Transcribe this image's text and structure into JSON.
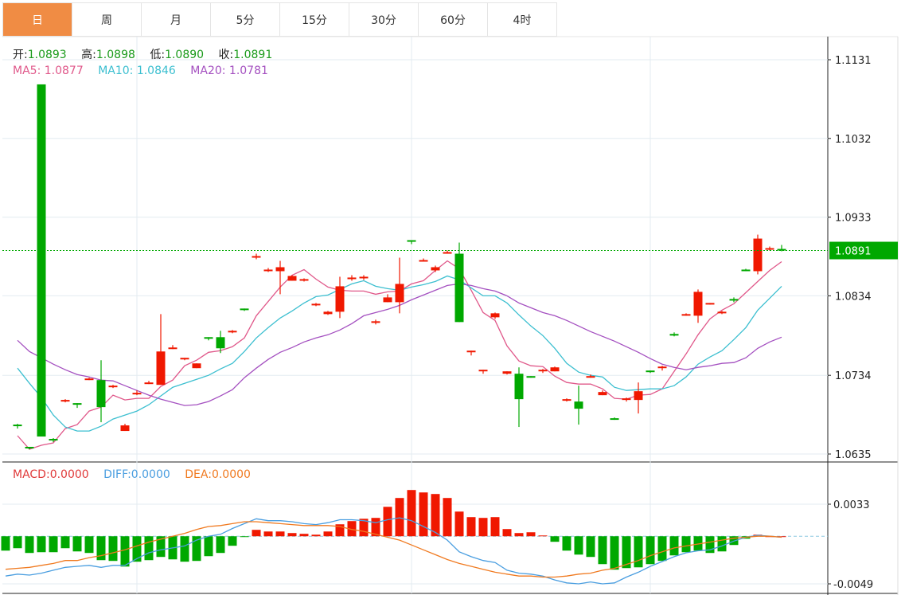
{
  "tabs": [
    {
      "label": "日",
      "active": true
    },
    {
      "label": "周",
      "active": false
    },
    {
      "label": "月",
      "active": false
    },
    {
      "label": "5分",
      "active": false
    },
    {
      "label": "15分",
      "active": false
    },
    {
      "label": "30分",
      "active": false
    },
    {
      "label": "60分",
      "active": false
    },
    {
      "label": "4时",
      "active": false
    }
  ],
  "ohlc_legend": {
    "open_label": "开:",
    "open": "1.0893",
    "high_label": "高:",
    "high": "1.0898",
    "low_label": "低:",
    "low": "1.0890",
    "close_label": "收:",
    "close": "1.0891"
  },
  "ma_legend": {
    "ma5_label": "MA5:",
    "ma5": "1.0877",
    "ma10_label": "MA10:",
    "ma10": "1.0846",
    "ma20_label": "MA20:",
    "ma20": "1.0781"
  },
  "macd_legend": {
    "macd_label": "MACD:",
    "macd": "0.0000",
    "diff_label": "DIFF:",
    "diff": "0.0000",
    "dea_label": "DEA:",
    "dea": "0.0000"
  },
  "colors": {
    "up": "#f01800",
    "down": "#00a800",
    "ma5": "#e0588a",
    "ma10": "#3cbfd0",
    "ma20": "#a450c0",
    "diff": "#4a9ee0",
    "dea": "#f07a20",
    "macd": "#e03a3a",
    "active_tab": "#f08c44"
  },
  "chart_data": [
    {
      "type": "candlestick",
      "title": "",
      "y_ticks": [
        "1.1131",
        "1.1032",
        "1.0933",
        "1.0834",
        "1.0734",
        "1.0635"
      ],
      "ylim": [
        1.0635,
        1.1131
      ],
      "last_price": "1.0891",
      "candles": [
        [
          1.0672,
          1.0673,
          1.0667,
          1.067
        ],
        [
          1.0644,
          1.0644,
          1.0641,
          1.0642
        ],
        [
          1.11,
          1.11,
          1.0657,
          1.0657
        ],
        [
          1.0654,
          1.0655,
          1.065,
          1.0652
        ],
        [
          1.0701,
          1.0704,
          1.07,
          1.0703
        ],
        [
          1.0699,
          1.0699,
          1.0693,
          1.0697
        ],
        [
          1.0728,
          1.0731,
          1.0728,
          1.073
        ],
        [
          1.0728,
          1.0753,
          1.0675,
          1.0694
        ],
        [
          1.0719,
          1.0722,
          1.0718,
          1.0721
        ],
        [
          1.0664,
          1.0673,
          1.0664,
          1.0671
        ],
        [
          1.071,
          1.0715,
          1.0709,
          1.0712
        ],
        [
          1.0723,
          1.0727,
          1.0723,
          1.0725
        ],
        [
          1.0722,
          1.0811,
          1.0722,
          1.0764
        ],
        [
          1.0767,
          1.0772,
          1.0767,
          1.0769
        ],
        [
          1.0754,
          1.0756,
          1.0753,
          1.0756
        ],
        [
          1.0743,
          1.0749,
          1.0743,
          1.0749
        ],
        [
          1.0782,
          1.0782,
          1.0778,
          1.078
        ],
        [
          1.0782,
          1.079,
          1.0762,
          1.0768
        ],
        [
          1.0788,
          1.0791,
          1.0787,
          1.079
        ],
        [
          1.0818,
          1.0818,
          1.0815,
          1.0816
        ],
        [
          1.0882,
          1.0887,
          1.088,
          1.0884
        ],
        [
          1.0865,
          1.0869,
          1.0864,
          1.0867
        ],
        [
          1.0865,
          1.0878,
          1.0836,
          1.087
        ],
        [
          1.0853,
          1.086,
          1.0853,
          1.0859
        ],
        [
          1.0853,
          1.0856,
          1.0852,
          1.0855
        ],
        [
          1.0822,
          1.0825,
          1.0821,
          1.0824
        ],
        [
          1.0811,
          1.0815,
          1.081,
          1.0814
        ],
        [
          1.0814,
          1.0858,
          1.0806,
          1.0846
        ],
        [
          1.0855,
          1.086,
          1.0853,
          1.0857
        ],
        [
          1.0856,
          1.086,
          1.0854,
          1.0858
        ],
        [
          1.08,
          1.0804,
          1.0798,
          1.0802
        ],
        [
          1.0826,
          1.0836,
          1.0826,
          1.0832
        ],
        [
          1.0826,
          1.0882,
          1.0812,
          1.0849
        ],
        [
          1.0904,
          1.0904,
          1.0899,
          1.0902
        ],
        [
          1.0877,
          1.0881,
          1.0877,
          1.0879
        ],
        [
          1.0866,
          1.0872,
          1.0864,
          1.087
        ],
        [
          1.0887,
          1.0891,
          1.0887,
          1.0889
        ],
        [
          1.0887,
          1.0901,
          1.0801,
          1.0801
        ],
        [
          1.0763,
          1.0765,
          1.0759,
          1.0765
        ],
        [
          1.0739,
          1.0741,
          1.0736,
          1.0741
        ],
        [
          1.0807,
          1.0813,
          1.0805,
          1.0812
        ],
        [
          1.0736,
          1.0739,
          1.0735,
          1.0739
        ],
        [
          1.0736,
          1.0744,
          1.0669,
          1.0704
        ],
        [
          1.0733,
          1.0733,
          1.0731,
          1.0731
        ],
        [
          1.0739,
          1.0742,
          1.0737,
          1.0741
        ],
        [
          1.0739,
          1.0745,
          1.0739,
          1.0744
        ],
        [
          1.0702,
          1.0705,
          1.0701,
          1.0704
        ],
        [
          1.0701,
          1.0721,
          1.0672,
          1.0692
        ],
        [
          1.0731,
          1.0735,
          1.0731,
          1.0733
        ],
        [
          1.0709,
          1.0715,
          1.0709,
          1.0713
        ],
        [
          1.068,
          1.0681,
          1.0678,
          1.0678
        ],
        [
          1.0703,
          1.0706,
          1.0701,
          1.0705
        ],
        [
          1.0703,
          1.0725,
          1.0686,
          1.0714
        ],
        [
          1.074,
          1.074,
          1.0737,
          1.0738
        ],
        [
          1.0743,
          1.0746,
          1.074,
          1.0745
        ],
        [
          1.0786,
          1.0788,
          1.0783,
          1.0784
        ],
        [
          1.0809,
          1.0812,
          1.0809,
          1.0811
        ],
        [
          1.0809,
          1.0842,
          1.08,
          1.0839
        ],
        [
          1.0823,
          1.0825,
          1.0823,
          1.0825
        ],
        [
          1.0812,
          1.0815,
          1.0811,
          1.0814
        ],
        [
          1.083,
          1.0832,
          1.0826,
          1.0828
        ],
        [
          1.0867,
          1.0868,
          1.0865,
          1.0865
        ],
        [
          1.0865,
          1.0911,
          1.0861,
          1.0906
        ],
        [
          1.0892,
          1.0896,
          1.0891,
          1.0894
        ],
        [
          1.0893,
          1.0898,
          1.089,
          1.0891
        ]
      ],
      "series": [
        {
          "name": "MA5",
          "values": [
            1.0658,
            1.0641,
            1.0646,
            1.0649,
            1.0667,
            1.0672,
            1.0689,
            1.0694,
            1.0709,
            1.0703,
            1.0705,
            1.0705,
            1.072,
            1.0728,
            1.0746,
            1.0753,
            1.0763,
            1.0765,
            1.077,
            1.0781,
            1.0809,
            1.0827,
            1.0845,
            1.086,
            1.0867,
            1.0855,
            1.0845,
            1.0841,
            1.084,
            1.084,
            1.0836,
            1.0839,
            1.084,
            1.0849,
            1.0853,
            1.0866,
            1.0878,
            1.0868,
            1.0841,
            1.0813,
            1.0803,
            1.0771,
            1.0752,
            1.0746,
            1.0745,
            1.0733,
            1.0725,
            1.0723,
            1.0723,
            1.0717,
            1.0705,
            1.0704,
            1.0709,
            1.071,
            1.0717,
            1.0739,
            1.0761,
            1.0785,
            1.0805,
            1.0816,
            1.0824,
            1.0838,
            1.0852,
            1.0866,
            1.0877
          ]
        },
        {
          "name": "MA10",
          "values": [
            1.0743,
            1.0724,
            1.0706,
            1.0684,
            1.0669,
            1.0664,
            1.0664,
            1.067,
            1.0679,
            1.0684,
            1.0689,
            1.0697,
            1.0708,
            1.0719,
            1.0724,
            1.0729,
            1.0734,
            1.0742,
            1.0749,
            1.0764,
            1.0781,
            1.0794,
            1.0806,
            1.0815,
            1.0825,
            1.0833,
            1.0835,
            1.0842,
            1.0849,
            1.0853,
            1.0846,
            1.0843,
            1.0841,
            1.0845,
            1.0848,
            1.0852,
            1.0859,
            1.0854,
            1.0844,
            1.0834,
            1.0834,
            1.0825,
            1.081,
            1.0796,
            1.0784,
            1.0768,
            1.0749,
            1.0738,
            1.0734,
            1.0732,
            1.0719,
            1.0715,
            1.0716,
            1.0717,
            1.0717,
            1.0721,
            1.0732,
            1.0748,
            1.0757,
            1.0765,
            1.0779,
            1.0794,
            1.0816,
            1.0831,
            1.0846
          ]
        },
        {
          "name": "MA20",
          "values": [
            1.0778,
            1.0764,
            1.0756,
            1.0748,
            1.0741,
            1.0735,
            1.0732,
            1.0728,
            1.0727,
            1.0721,
            1.0715,
            1.0709,
            1.0704,
            1.07,
            1.0696,
            1.0697,
            1.0701,
            1.0708,
            1.0716,
            1.0731,
            1.0743,
            1.0754,
            1.0763,
            1.0769,
            1.0776,
            1.0781,
            1.0785,
            1.0791,
            1.0799,
            1.0809,
            1.0813,
            1.0817,
            1.0822,
            1.0829,
            1.0835,
            1.0841,
            1.0847,
            1.0849,
            1.0847,
            1.0843,
            1.084,
            1.0834,
            1.0825,
            1.0819,
            1.0813,
            1.0809,
            1.0803,
            1.0796,
            1.0789,
            1.0783,
            1.0777,
            1.077,
            1.0763,
            1.0755,
            1.0748,
            1.0744,
            1.0741,
            1.0744,
            1.0746,
            1.0749,
            1.075,
            1.0756,
            1.0768,
            1.0776,
            1.0782
          ]
        }
      ]
    },
    {
      "type": "bar+line",
      "title": "MACD",
      "y_ticks": [
        "0.0033",
        "-0.0049"
      ],
      "ylim": [
        -0.0049,
        0.0033
      ],
      "macd": [
        -0.00148,
        -0.00123,
        -0.00172,
        -0.00164,
        -0.00164,
        -0.00123,
        -0.00156,
        -0.00172,
        -0.00246,
        -0.00254,
        -0.00312,
        -0.00262,
        -0.00246,
        -0.00213,
        -0.00238,
        -0.00262,
        -0.00254,
        -0.00205,
        -0.00172,
        -0.00098,
        -8e-05,
        0.00066,
        0.00049,
        0.00049,
        0.00033,
        0.00025,
        0.00016,
        0.00049,
        0.00123,
        0.00156,
        0.0018,
        0.00189,
        0.00303,
        0.00394,
        0.00476,
        0.00451,
        0.00435,
        0.00394,
        0.00254,
        0.00197,
        0.00189,
        0.00197,
        0.00074,
        0.00033,
        0.00041,
        8e-05,
        -0.00057,
        -0.00148,
        -0.00189,
        -0.00213,
        -0.00287,
        -0.00344,
        -0.00328,
        -0.0032,
        -0.00287,
        -0.00254,
        -0.00197,
        -0.00164,
        -0.00148,
        -0.00172,
        -0.00156,
        -0.0009,
        -0.00025,
        0.00016,
        0,
        0
      ],
      "series": [
        {
          "name": "DIFF",
          "values": [
            -0.0041,
            -0.0039,
            -0.004,
            -0.0038,
            -0.0035,
            -0.0032,
            -0.0031,
            -0.003,
            -0.0032,
            -0.003,
            -0.003,
            -0.0023,
            -0.0017,
            -0.0014,
            -0.0012,
            -0.001,
            -0.0004,
            0,
            0.0002,
            0.0008,
            0.0013,
            0.0018,
            0.0016,
            0.0016,
            0.0015,
            0.0013,
            0.0012,
            0.0014,
            0.0017,
            0.0017,
            0.0016,
            0.0014,
            0.0017,
            0.0019,
            0.0016,
            0.001,
            0.0004,
            -0.0004,
            -0.0016,
            -0.0021,
            -0.0025,
            -0.0027,
            -0.0035,
            -0.0038,
            -0.0039,
            -0.0041,
            -0.0045,
            -0.0048,
            -0.0049,
            -0.0047,
            -0.0049,
            -0.0048,
            -0.0042,
            -0.0037,
            -0.0031,
            -0.0026,
            -0.0021,
            -0.0017,
            -0.0015,
            -0.0014,
            -0.001,
            -0.0005,
            -0.0001,
            0.0001,
            0,
            -0.0001
          ]
        },
        {
          "name": "DEA",
          "values": [
            -0.0034,
            -0.0033,
            -0.0032,
            -0.003,
            -0.0028,
            -0.0025,
            -0.0025,
            -0.0022,
            -0.002,
            -0.0017,
            -0.0014,
            -0.001,
            -0.0006,
            -0.0003,
            0,
            0.0003,
            0.0007,
            0.001,
            0.0011,
            0.0013,
            0.0015,
            0.0015,
            0.0014,
            0.0013,
            0.0012,
            0.0011,
            0.0011,
            0.0011,
            0.001,
            0.0007,
            0.0005,
            0.0002,
            -0.0001,
            -0.0004,
            -0.0009,
            -0.0014,
            -0.0019,
            -0.0024,
            -0.0028,
            -0.0031,
            -0.0034,
            -0.0037,
            -0.0039,
            -0.0041,
            -0.0041,
            -0.0042,
            -0.0042,
            -0.0041,
            -0.0039,
            -0.0038,
            -0.0035,
            -0.0033,
            -0.0029,
            -0.0025,
            -0.002,
            -0.0016,
            -0.0012,
            -0.001,
            -0.0008,
            -0.0006,
            -0.0004,
            -0.0002,
            -0.0001,
            0,
            0,
            -0.0001
          ]
        }
      ]
    }
  ]
}
